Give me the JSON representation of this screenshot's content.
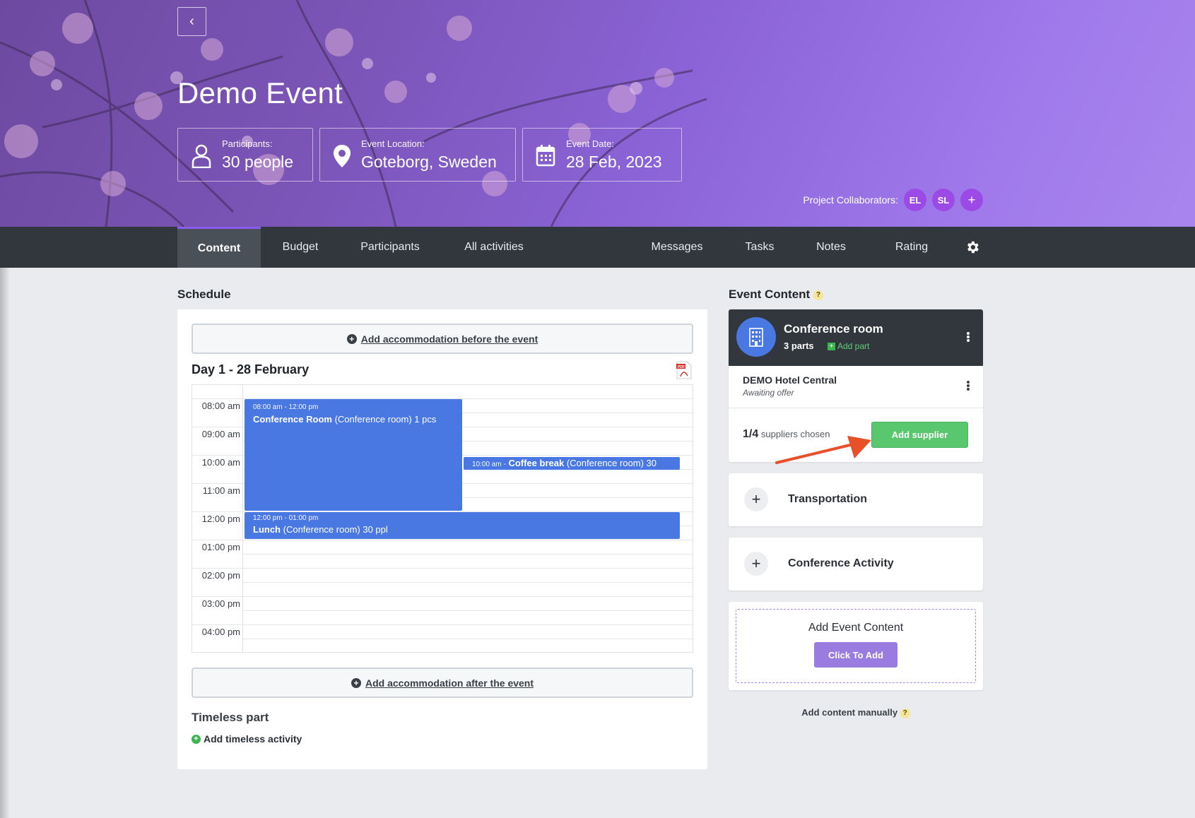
{
  "header": {
    "back_icon": "chevron-left-icon",
    "title": "Demo Event",
    "participants_label": "Participants:",
    "participants_value": "30 people",
    "location_label": "Event Location:",
    "location_value": "Goteborg, Sweden",
    "date_label": "Event Date:",
    "date_value": "28 Feb, 2023",
    "collaborators_label": "Project Collaborators:",
    "collaborators": [
      "EL",
      "SL"
    ],
    "add_collaborator": "+"
  },
  "nav": {
    "tabs": [
      "Content",
      "Budget",
      "Participants",
      "All activities",
      "Messages",
      "Tasks",
      "Notes",
      "Rating"
    ],
    "active": "Content",
    "settings_icon": "gear-icon"
  },
  "schedule": {
    "heading": "Schedule",
    "add_before": "Add accommodation before the event",
    "add_after": "Add accommodation after the event",
    "day_title": "Day 1 - 28 February",
    "times": [
      "08:00 am",
      "09:00 am",
      "10:00 am",
      "11:00 am",
      "12:00 pm",
      "01:00 pm",
      "02:00 pm",
      "03:00 pm",
      "04:00 pm"
    ],
    "events": [
      {
        "time": "08:00 am - 12:00 pm",
        "name": "Conference Room",
        "detail": "(Conference room) 1 pcs"
      },
      {
        "time": "10:00 am -",
        "name": "Coffee break",
        "detail": "(Conference room) 30"
      },
      {
        "time": "12:00 pm - 01:00 pm",
        "name": "Lunch",
        "detail": "(Conference room) 30 ppl"
      }
    ],
    "timeless_heading": "Timeless part",
    "add_timeless": "Add timeless activity"
  },
  "content": {
    "heading": "Event Content",
    "help": "?",
    "conference": {
      "name": "Conference room",
      "parts": "3 parts",
      "add_part": "Add part",
      "hotel": "DEMO Hotel Central",
      "status": "Awaiting offer",
      "suppliers_count": "1/4",
      "suppliers_text": "suppliers chosen",
      "add_supplier": "Add supplier"
    },
    "transportation": "Transportation",
    "conference_activity": "Conference Activity",
    "add_event_content": "Add Event Content",
    "click_to_add": "Click To Add",
    "add_manually": "Add content manually"
  },
  "colors": {
    "accent": "#8a5cf0",
    "event_blue": "#4a78e3",
    "nav": "#32373d",
    "success": "#58c76d",
    "arrow": "#e8502a"
  }
}
